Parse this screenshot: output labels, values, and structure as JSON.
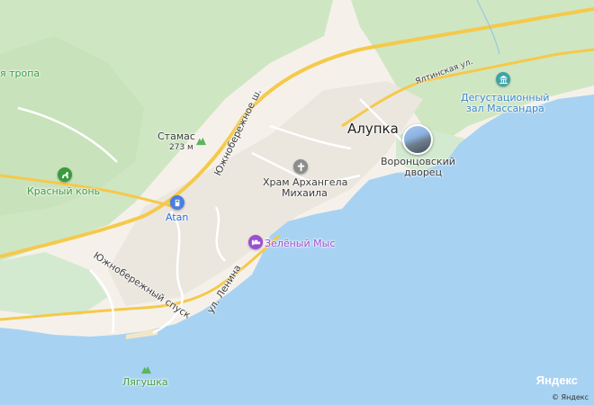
{
  "map": {
    "colors": {
      "sea": "#a8d2f2",
      "land": "#f5f1ea",
      "forest": "#cfe6c3",
      "forest_dark": "#bcdcaf",
      "road_major": "#f5c94a",
      "road_minor": "#ffffff",
      "built": "#ebe6de"
    },
    "labels": {
      "trail": "я тропа",
      "stamas": "Стамас",
      "stamas_elev": "273 м",
      "red_horse": "Красный конь",
      "atan": "Atan",
      "road_yuzhnoberezhnoe": "Южнобережное ш.",
      "road_yuzhnoberezhny_spusk": "Южнобережный спуск",
      "road_lenina": "ул. Ленина",
      "road_yaltinskaya": "Ялтинская ул.",
      "city_alupka": "Алупка",
      "church_line1": "Храм Архангела",
      "church_line2": "Михаила",
      "vorontsov_line1": "Воронцовский",
      "vorontsov_line2": "дворец",
      "massandra_line1": "Дегустационный",
      "massandra_line2": "зал Массандра",
      "hotel": "Зелёный Мыс",
      "lyagushka": "Лягушка",
      "brand": "Яндекс",
      "copyright": "© Яндекс"
    },
    "icons": [
      "hiking-icon",
      "mountain-peak-icon",
      "horse-riding-icon",
      "gas-station-icon",
      "church-icon",
      "museum-photo-icon",
      "museum-icon",
      "hotel-icon"
    ]
  }
}
